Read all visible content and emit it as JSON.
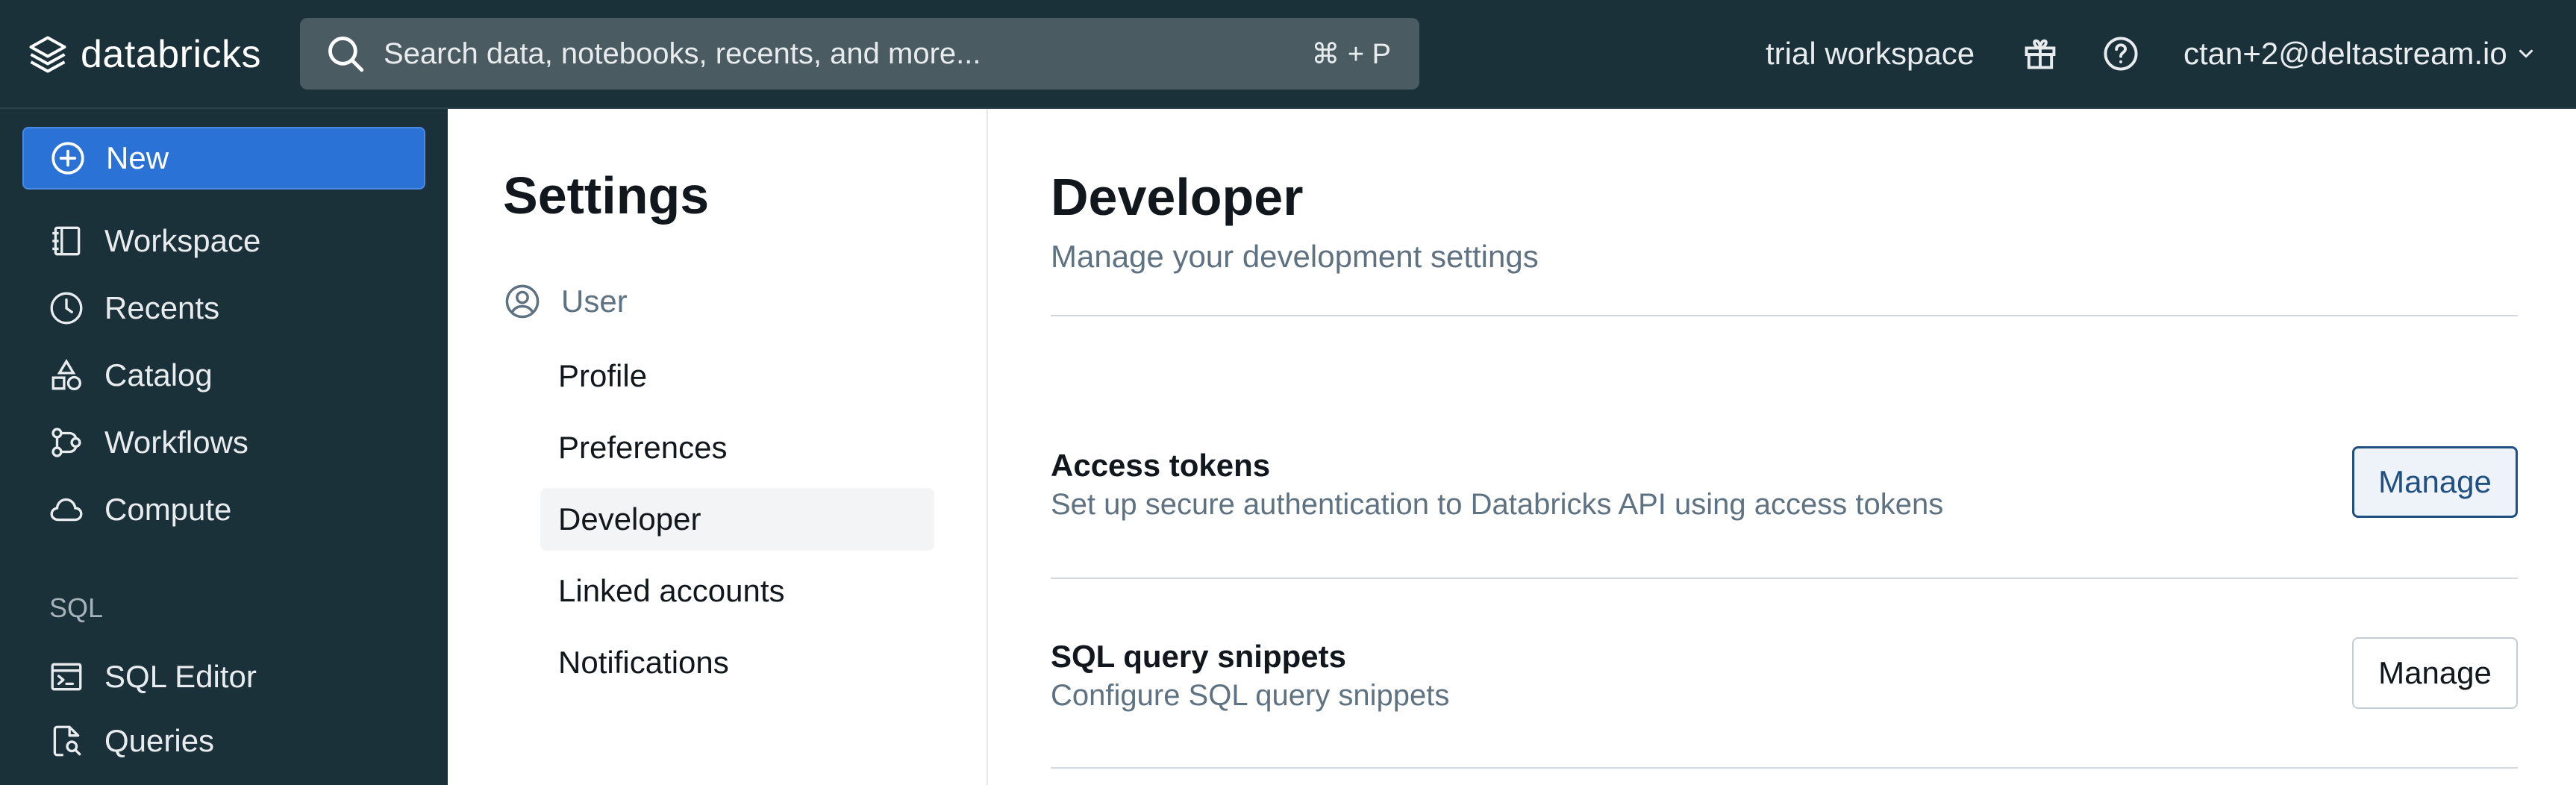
{
  "header": {
    "brand": "databricks",
    "search": {
      "placeholder": "Search data, notebooks, recents, and more...",
      "shortcut": "⌘ + P"
    },
    "workspace": "trial workspace",
    "user": "ctan+2@deltastream.io",
    "icons": [
      "databricks-logo",
      "search-icon",
      "gift-icon",
      "help-icon",
      "chevron-down-icon"
    ]
  },
  "sidebar": {
    "new_label": "New",
    "items": [
      {
        "label": "Workspace",
        "icon": "workspace-icon"
      },
      {
        "label": "Recents",
        "icon": "clock-icon"
      },
      {
        "label": "Catalog",
        "icon": "catalog-icon"
      },
      {
        "label": "Workflows",
        "icon": "workflows-icon"
      },
      {
        "label": "Compute",
        "icon": "cloud-icon"
      }
    ],
    "section_sql": "SQL",
    "sql_items": [
      {
        "label": "SQL Editor",
        "icon": "sql-editor-icon"
      },
      {
        "label": "Queries",
        "icon": "queries-icon"
      }
    ]
  },
  "settings": {
    "title": "Settings",
    "group_label": "User",
    "links": [
      "Profile",
      "Preferences",
      "Developer",
      "Linked accounts",
      "Notifications"
    ],
    "active": "Developer"
  },
  "main": {
    "title": "Developer",
    "subtitle": "Manage your development settings",
    "rows": [
      {
        "title": "Access tokens",
        "description": "Set up secure authentication to Databricks API using access tokens",
        "button": "Manage"
      },
      {
        "title": "SQL query snippets",
        "description": "Configure SQL query snippets",
        "button": "Manage"
      }
    ]
  },
  "colors": {
    "topbar": "#1b3139",
    "accent": "#2b72d6",
    "focus": "#1f4f83"
  }
}
